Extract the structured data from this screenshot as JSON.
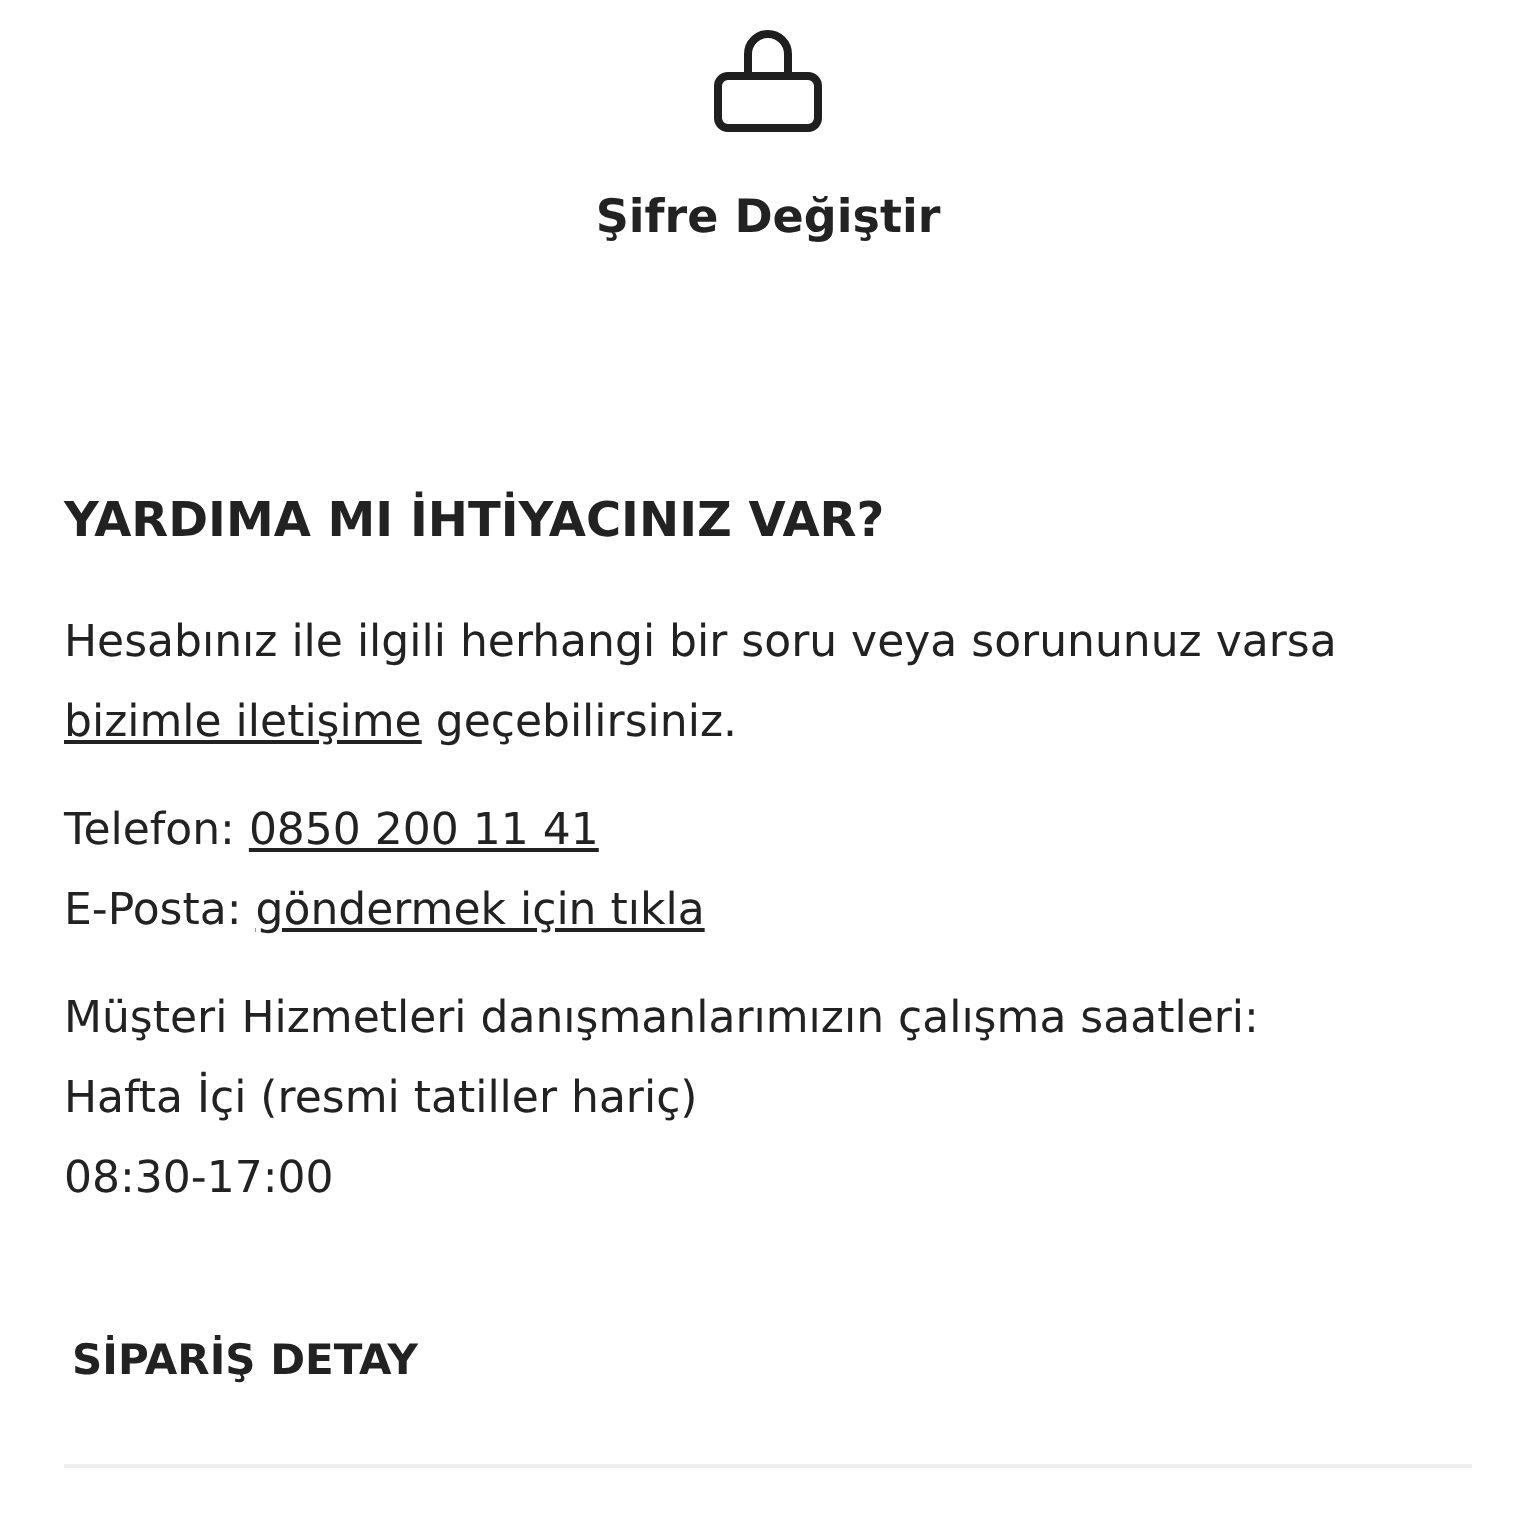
{
  "change_password": {
    "label": "Şifre Değiştir"
  },
  "help": {
    "title": "YARDIMA MI İHTİYACINIZ VAR?",
    "intro": {
      "before": "Hesabınız ile ilgili herhangi bir soru veya sorununuz varsa ",
      "link": "bizimle iletişime",
      "after": " geçebilirsiniz."
    },
    "contacts": [
      {
        "label": "Telefon: ",
        "link": "0850 200 11 41"
      },
      {
        "label": "E-Posta: ",
        "link": "göndermek için tıkla"
      }
    ],
    "hours": [
      "Müşteri Hizmetleri danışmanlarımızın çalışma saatleri:",
      "Hafta İçi (resmi tatiller hariç)",
      "08:30-17:00"
    ]
  },
  "order_detail": {
    "title": "SİPARİŞ DETAY"
  }
}
